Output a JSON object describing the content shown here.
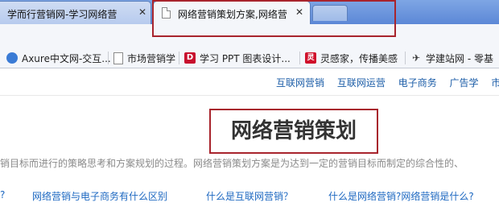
{
  "tabs": [
    {
      "title": "学而行营销网-学习网络营",
      "active": false
    },
    {
      "title": "网络营销策划方案,网络营",
      "active": true
    }
  ],
  "close_glyph": "✕",
  "bookmarks": [
    {
      "label": "Axure中文网-交互...",
      "icon": "axure-icon",
      "color": "#3a7bd5"
    },
    {
      "label": "市场营销学",
      "icon": "page-icon",
      "color": "#8a8a8a"
    },
    {
      "label": "学习 PPT 图表设计...",
      "icon": "ppt-d-icon",
      "color": "#c8102e",
      "glyph": "D"
    },
    {
      "label": "灵感家，传播美感",
      "icon": "lingganjia-icon",
      "color": "#d0112b",
      "glyph": "灵"
    },
    {
      "label": "学建站网 - 零基",
      "icon": "plane-icon",
      "color": "#333333"
    }
  ],
  "subnav": [
    "互联网营销",
    "互联网运营",
    "电子商务",
    "广告学",
    "市场"
  ],
  "page_title": "网络营销策划",
  "description": "销目标而进行的策略思考和方案规划的过程。网络营销策划方案是为达到一定的营销目标而制定的综合性的、",
  "related_links": [
    "?",
    "网络营销与电子商务有什么区别",
    "什么是互联网营销？",
    "什么是网络营销?网络营销是什么?"
  ],
  "colors": {
    "highlight": "#a8242d",
    "link": "#1d68c1",
    "tabstrip": "#6a95dd"
  }
}
